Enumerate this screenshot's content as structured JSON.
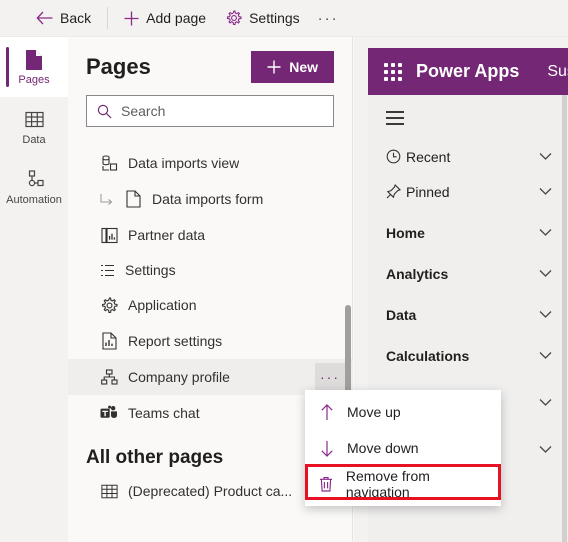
{
  "commandbar": {
    "back_label": "Back",
    "add_page_label": "Add page",
    "settings_label": "Settings",
    "overflow_label": "···"
  },
  "rail": {
    "items": [
      {
        "label": "Pages",
        "icon": "page-icon",
        "selected": true
      },
      {
        "label": "Data",
        "icon": "table-icon",
        "selected": false
      },
      {
        "label": "Automation",
        "icon": "automation-icon",
        "selected": false
      }
    ]
  },
  "pages_pane": {
    "title": "Pages",
    "new_button_label": "New",
    "search_placeholder": "Search",
    "search_value": "",
    "more_button_label": "···",
    "items": [
      {
        "label": "Data imports view",
        "icon": "data-view-icon",
        "indent": false,
        "group": false,
        "more": false
      },
      {
        "label": "Data imports form",
        "icon": "form-page-icon",
        "indent": true,
        "group": false,
        "more": false
      },
      {
        "label": "Partner data",
        "icon": "dashboard-icon",
        "indent": false,
        "group": false,
        "more": false
      },
      {
        "label": "Settings",
        "icon": "group-list-icon",
        "indent": false,
        "group": true,
        "more": false
      },
      {
        "label": "Application",
        "icon": "gear-icon",
        "indent": false,
        "group": false,
        "more": false
      },
      {
        "label": "Report settings",
        "icon": "report-icon",
        "indent": false,
        "group": false,
        "more": false
      },
      {
        "label": "Company profile",
        "icon": "org-chart-icon",
        "indent": false,
        "group": false,
        "more": true
      },
      {
        "label": "Teams chat",
        "icon": "teams-icon",
        "indent": false,
        "group": false,
        "more": false
      }
    ],
    "other_pages_header": "All other pages",
    "other_pages": [
      {
        "label": "(Deprecated) Product ca...",
        "icon": "table-icon"
      }
    ]
  },
  "context_menu": {
    "items": [
      {
        "label": "Move up",
        "icon": "arrow-up-icon",
        "highlighted": false
      },
      {
        "label": "Move down",
        "icon": "arrow-down-icon",
        "highlighted": false
      },
      {
        "label": "Remove from navigation",
        "icon": "trash-icon",
        "highlighted": true
      }
    ]
  },
  "preview": {
    "brand": "Power Apps",
    "app_name": "Susta",
    "nav_items": [
      {
        "label": "Recent",
        "icon": "clock-icon",
        "bold": false,
        "chevron": true
      },
      {
        "label": "Pinned",
        "icon": "pin-icon",
        "bold": false,
        "chevron": true
      },
      {
        "label": "Home",
        "icon": "",
        "bold": true,
        "chevron": true
      },
      {
        "label": "Analytics",
        "icon": "",
        "bold": true,
        "chevron": true
      },
      {
        "label": "Data",
        "icon": "",
        "bold": true,
        "chevron": true
      },
      {
        "label": "Calculations",
        "icon": "",
        "bold": true,
        "chevron": true
      },
      {
        "label": "",
        "icon": "",
        "bold": true,
        "chevron": true
      },
      {
        "label": "",
        "icon": "",
        "bold": true,
        "chevron": true
      }
    ]
  },
  "colors": {
    "brand_purple": "#742774",
    "accent_purple": "#8a2b8a",
    "highlight_red": "#e81123",
    "pane_bg": "#faf9f8"
  }
}
